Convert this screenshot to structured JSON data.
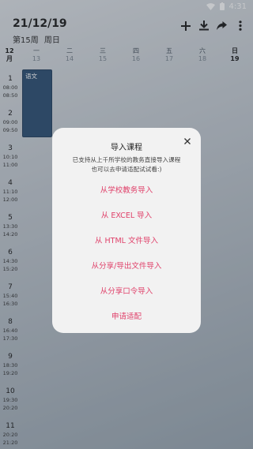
{
  "status": {
    "time": "4:31"
  },
  "header": {
    "date": "21/12/19",
    "week_label": "第15周",
    "weekday": "周日"
  },
  "icons": [
    "add-icon",
    "download-icon",
    "share-icon",
    "more-vert-icon"
  ],
  "month": {
    "num": "12",
    "unit": "月"
  },
  "days": [
    {
      "label": "一",
      "date": "13"
    },
    {
      "label": "二",
      "date": "14"
    },
    {
      "label": "三",
      "date": "15"
    },
    {
      "label": "四",
      "date": "16"
    },
    {
      "label": "五",
      "date": "17"
    },
    {
      "label": "六",
      "date": "18"
    },
    {
      "label": "日",
      "date": "19"
    }
  ],
  "slots": [
    {
      "n": "1",
      "start": "08:00",
      "end": "08:50"
    },
    {
      "n": "2",
      "start": "09:00",
      "end": "09:50"
    },
    {
      "n": "3",
      "start": "10:10",
      "end": "11:00"
    },
    {
      "n": "4",
      "start": "11:10",
      "end": "12:00"
    },
    {
      "n": "5",
      "start": "13:30",
      "end": "14:20"
    },
    {
      "n": "6",
      "start": "14:30",
      "end": "15:20"
    },
    {
      "n": "7",
      "start": "15:40",
      "end": "16:30"
    },
    {
      "n": "8",
      "start": "16:40",
      "end": "17:30"
    },
    {
      "n": "9",
      "start": "18:30",
      "end": "19:20"
    },
    {
      "n": "10",
      "start": "19:30",
      "end": "20:20"
    },
    {
      "n": "11",
      "start": "20:20",
      "end": "21:20"
    }
  ],
  "course": {
    "name": "语文"
  },
  "dialog": {
    "title": "导入课程",
    "desc_line1": "已支持从上千所学校的教务直接导入课程",
    "desc_line2": "也可以去申请适配试试看:)",
    "options": [
      "从学校教务导入",
      "从 EXCEL 导入",
      "从 HTML 文件导入",
      "从分享/导出文件导入",
      "从分享口令导入",
      "申请适配"
    ]
  },
  "colors": {
    "accent": "#e0426b",
    "course": "#2d4f73"
  }
}
